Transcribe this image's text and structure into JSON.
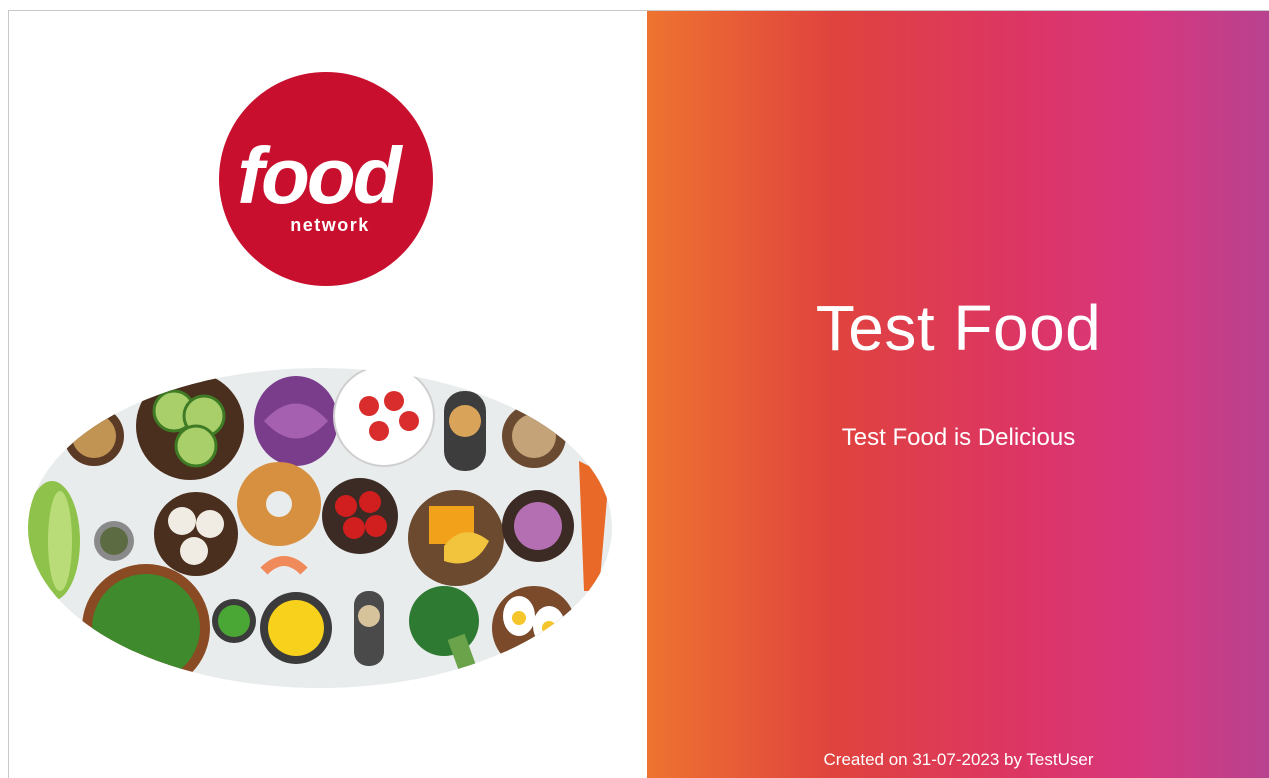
{
  "logo": {
    "word": "food",
    "sub": "network",
    "color": "#c8102e"
  },
  "slide": {
    "title": "Test Food",
    "subtitle": "Test Food is Delicious",
    "created": "Created on 31-07-2023 by TestUser"
  },
  "colors": {
    "gradient_start": "#ee7330",
    "gradient_mid": "#dc3564",
    "gradient_end": "#b8428f"
  }
}
